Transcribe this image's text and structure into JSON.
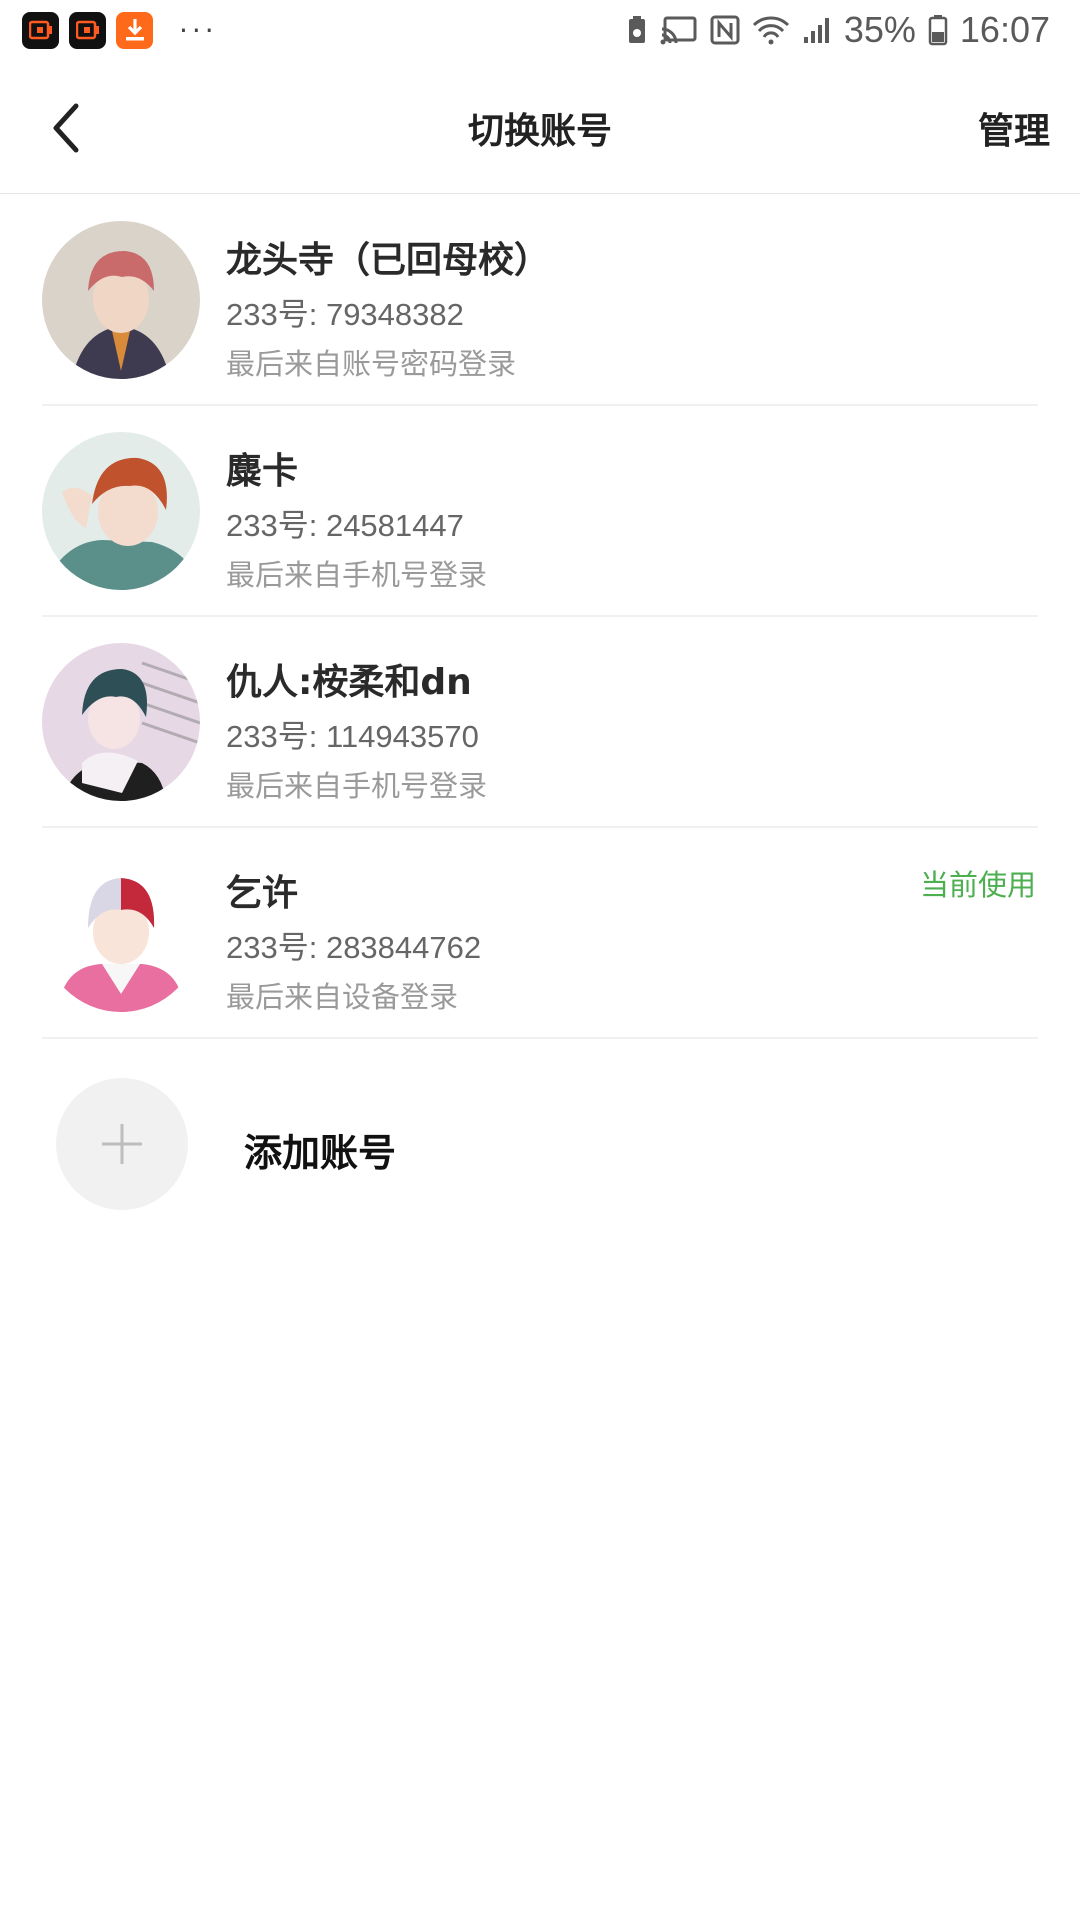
{
  "status_bar": {
    "battery_pct": "35%",
    "time": "16:07",
    "icons": [
      "video-app-icon",
      "video-app-icon",
      "download-app-icon",
      "more-dots-icon",
      "battery-saver-icon",
      "cast-icon",
      "nfc-icon",
      "wifi-icon",
      "signal-icon",
      "battery-icon"
    ]
  },
  "nav": {
    "title": "切换账号",
    "manage_label": "管理"
  },
  "accounts": [
    {
      "name": "龙头寺（已回母校）",
      "id": "233号: 79348382",
      "source": "最后来自账号密码登录",
      "avatar_colors": [
        "#c96b6b",
        "#d9d3c9"
      ]
    },
    {
      "name": "麋卡",
      "id": "233号: 24581447",
      "source": "最后来自手机号登录",
      "avatar_colors": [
        "#c0532e",
        "#5a8f8a"
      ]
    },
    {
      "name": "仇人:桉柔和dn",
      "id": "233号: 114943570",
      "source": "最后来自手机号登录",
      "avatar_colors": [
        "#2f4f56",
        "#e7d8e6"
      ]
    },
    {
      "name": "乞许",
      "id": "233号: 283844762",
      "source": "最后来自设备登录",
      "badge": "当前使用",
      "avatar_colors": [
        "#c3293b",
        "#d9d6e6"
      ]
    }
  ],
  "add_account": {
    "label": "添加账号"
  },
  "colors": {
    "accent_green": "#4caf50",
    "orange_app": "#ff6a1a"
  }
}
